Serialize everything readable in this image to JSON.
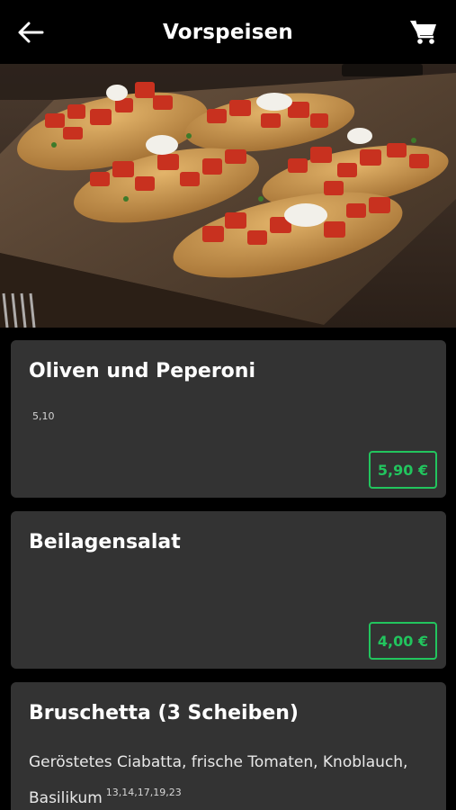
{
  "header": {
    "title": "Vorspeisen",
    "back_icon": "arrow-left-icon",
    "cart_icon": "shopping-cart-icon"
  },
  "hero": {
    "image_alt": "bruschetta-photo"
  },
  "items": [
    {
      "name": "Oliven und Peperoni",
      "allergens": "5,10",
      "description": "",
      "price": "5,90 €"
    },
    {
      "name": "Beilagensalat",
      "allergens": "",
      "description": "",
      "price": "4,00 €"
    },
    {
      "name": "Bruschetta (3 Scheiben)",
      "allergens": "13,14,17,19,23",
      "description": "Geröstetes Ciabatta, frische Tomaten, Knoblauch, Basilikum",
      "price": ""
    }
  ],
  "colors": {
    "background": "#000000",
    "card": "#333333",
    "price_accent": "#22c55e"
  }
}
